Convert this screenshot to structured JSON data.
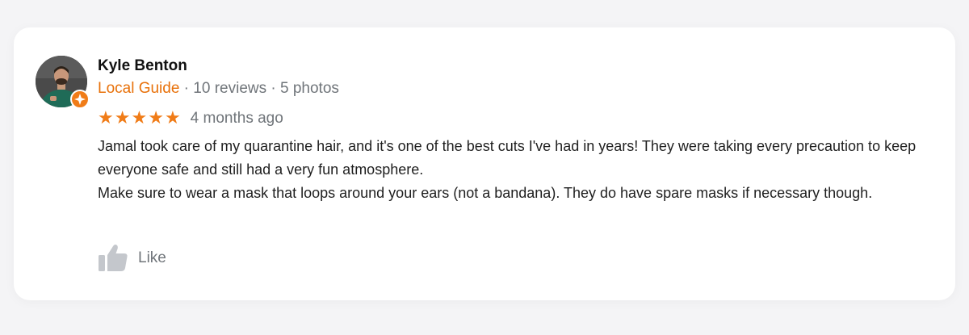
{
  "review": {
    "author_name": "Kyle Benton",
    "badge": "Local Guide",
    "stats": " · 10 reviews · 5 photos",
    "rating": 5,
    "stars": [
      "★",
      "★",
      "★",
      "★",
      "★"
    ],
    "time": "4 months ago",
    "paragraphs": [
      "Jamal took care of my quarantine hair, and it's one of the best cuts I've had in years! They were taking every precaution to keep everyone safe and still had a very fun atmosphere.",
      "Make sure to wear a mask that loops around your ears (not a bandana). They do have spare masks if necessary though."
    ],
    "like_label": "Like"
  },
  "colors": {
    "accent": "#e8710a",
    "star": "#f07c18",
    "muted": "#70757a"
  },
  "icons": {
    "avatar": "avatar-photo",
    "badge": "local-guide-badge-icon",
    "like": "thumbs-up-icon"
  }
}
